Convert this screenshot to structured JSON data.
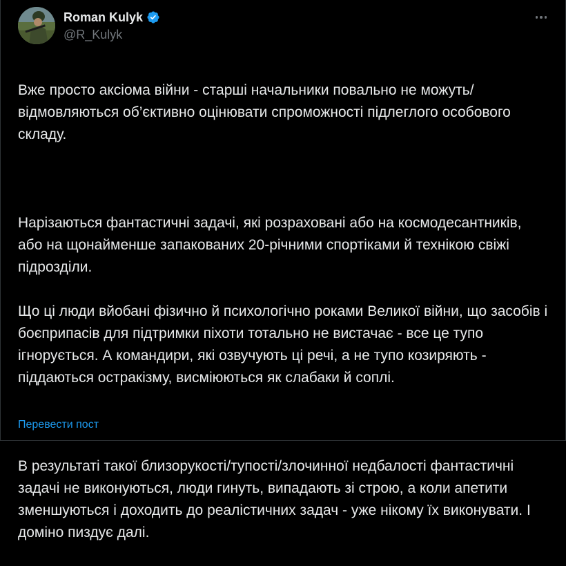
{
  "author": {
    "display_name": "Roman Kulyk",
    "handle": "@R_Kulyk",
    "verified": true,
    "verified_color": "#1d9bf0"
  },
  "tweet": {
    "paragraph_1": "Вже просто аксіома війни - старші начальники повально не можуть/ відмовляються об’єктивно оцінювати спроможності підлеглого особового складу.",
    "paragraph_2a": "Нарізаються фантастичні задачі, які розраховані або на космодесантників, або на щонайменше запакованих 20-річними спортіками й технікою свіжі підрозділи.",
    "paragraph_2b": "Що ці люди вйобані фізично й психологічно роками Великої війни, що засобів і боєприпасів для підтримки піхоти тотально не вистачає - все це тупо ігнорується. А командири, які озвучують ці речі, а не тупо козиряють - піддаються остракізму, висміюються як слабаки й соплі.",
    "paragraph_3": "В результаті такої близорукості/тупості/злочинної недбалості фантастичні задачі не виконуються, люди гинуть, випадають зі строю, а коли апетити зменшуються і доходить до реалістичних задач - уже нікому їх виконувати. І доміно пиздує далі."
  },
  "actions": {
    "translate_label": "Перевести пост",
    "more_icon": "more-horizontal-icon"
  },
  "colors": {
    "background": "#000000",
    "text": "#e7e9ea",
    "secondary": "#71767b",
    "accent": "#1d9bf0"
  }
}
